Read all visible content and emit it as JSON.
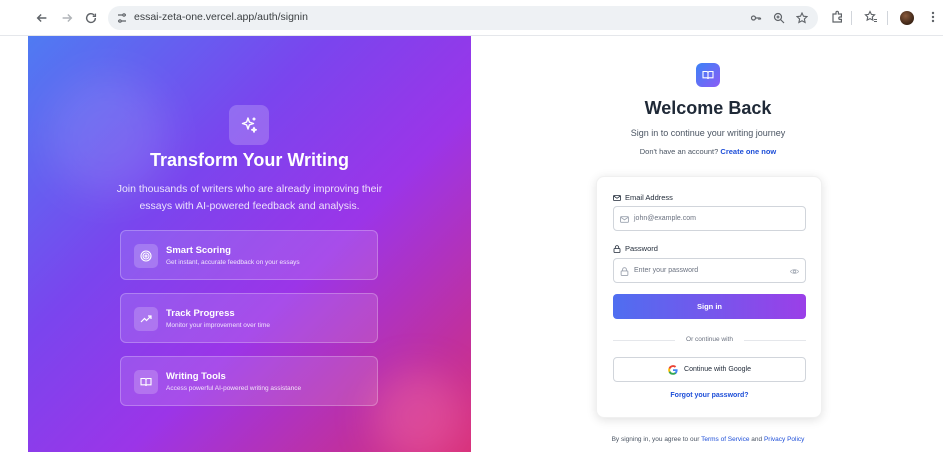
{
  "browser": {
    "url": "essai-zeta-one.vercel.app/auth/signin",
    "back_icon": "arrow-left-icon",
    "forward_icon": "arrow-right-icon",
    "reload_icon": "reload-icon"
  },
  "hero": {
    "badge_icon": "sparkles-icon",
    "title": "Transform Your Writing",
    "subtitle": "Join thousands of writers who are already improving their essays with AI-powered feedback and analysis.",
    "features": [
      {
        "icon": "target-icon",
        "title": "Smart Scoring",
        "description": "Get instant, accurate feedback on your essays"
      },
      {
        "icon": "trending-up-icon",
        "title": "Track Progress",
        "description": "Monitor your improvement over time"
      },
      {
        "icon": "book-open-icon",
        "title": "Writing Tools",
        "description": "Access powerful AI-powered writing assistance"
      }
    ]
  },
  "auth": {
    "logo_icon": "book-open-icon",
    "title": "Welcome Back",
    "subtitle": "Sign in to continue your writing journey",
    "no_account_text": "Don't have an account?",
    "create_link": "Create one now",
    "email_label": "Email Address",
    "email_placeholder": "john@example.com",
    "password_label": "Password",
    "password_placeholder": "Enter your password",
    "signin_button": "Sign in",
    "divider_text": "Or continue with",
    "google_button": "Continue with Google",
    "forgot_link": "Forgot your password?",
    "terms_prefix": "By signing in, you agree to our",
    "terms_link": "Terms of Service",
    "terms_and": "and",
    "privacy_link": "Privacy Policy"
  }
}
